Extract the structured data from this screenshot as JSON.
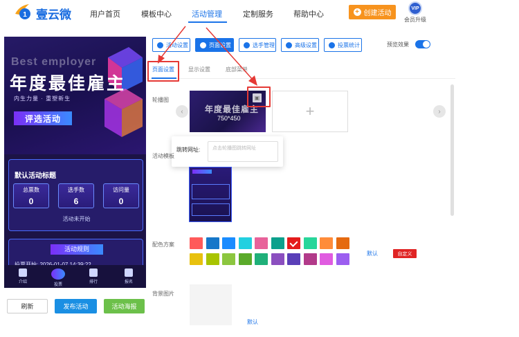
{
  "brand": {
    "name": "壹云微"
  },
  "nav": {
    "items": [
      {
        "label": "用户首页"
      },
      {
        "label": "模板中心"
      },
      {
        "label": "活动管理"
      },
      {
        "label": "定制服务"
      },
      {
        "label": "帮助中心"
      }
    ],
    "active_index": 2,
    "create_button": "创建活动",
    "vip_text": "VIP",
    "vip_label": "会员升级"
  },
  "phone": {
    "hero_en": "Best employer",
    "hero_title": "年度最佳雇主",
    "hero_sub": "内生力量 · 重塑新生",
    "hero_button": "评选活动",
    "stats_title": "默认活动标题",
    "stats": [
      {
        "label": "总票数",
        "value": "0"
      },
      {
        "label": "选手数",
        "value": "6"
      },
      {
        "label": "访问量",
        "value": "0"
      }
    ],
    "status": "活动未开始",
    "rules_title": "活动规则",
    "vote_start": "投票开始: 2026-01-07 14:39:22",
    "tabs": [
      {
        "label": "介绍"
      },
      {
        "label": "投票"
      },
      {
        "label": "排行"
      },
      {
        "label": "报名"
      }
    ]
  },
  "bottom_buttons": {
    "refresh": "刷新",
    "publish": "发布活动",
    "poster": "活动海报"
  },
  "toolbar": {
    "buttons": [
      {
        "label": "活动设置"
      },
      {
        "label": "页面设置"
      },
      {
        "label": "选手管理"
      },
      {
        "label": "高级设置"
      },
      {
        "label": "投票统计"
      }
    ],
    "active_index": 1,
    "preview_label": "预览效果",
    "preview_on": true
  },
  "subtabs": [
    {
      "label": "页面设置"
    },
    {
      "label": "显示设置"
    },
    {
      "label": "底部菜单"
    }
  ],
  "fields": {
    "carousel_label": "轮播图",
    "carousel_image_title": "年度最佳雇主",
    "carousel_image_size": "750*450",
    "jump_label": "跳转网址:",
    "jump_placeholder": "点击轮播图跳转网址",
    "template_label": "活动模板",
    "color_label": "配色方案",
    "color_default": "默认",
    "color_custom": "自定义",
    "bg_label": "背景图片",
    "bg_default": "默认"
  },
  "colors": [
    [
      "#ff5a5a",
      "#1677c9",
      "#1a8cff",
      "#22d0e0",
      "#e8629a",
      "#0ca08c",
      "#e41b1b",
      "#28d69a",
      "#ff8c3a",
      "#e56a10"
    ],
    [
      "#e8c10e",
      "#a8c400",
      "#8cc63f",
      "#5aaa2a",
      "#1fb079",
      "#8b4fbf",
      "#5a3fb8",
      "#b23a8a",
      "#e05ce0",
      "#9c5ef0"
    ]
  ],
  "selected_color": "#e41b1b"
}
